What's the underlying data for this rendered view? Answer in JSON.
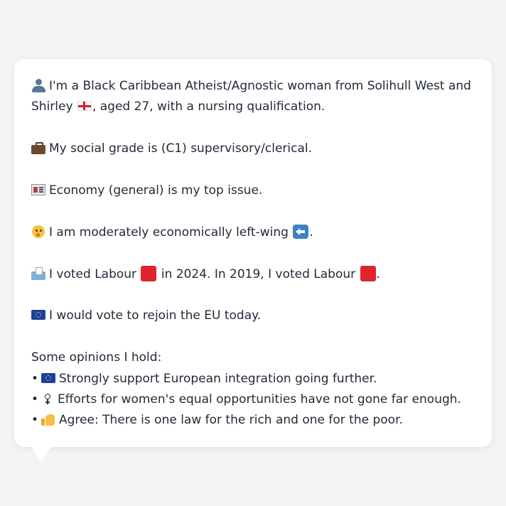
{
  "persona": {
    "intro_line1": "I'm a Black Caribbean Atheist/Agnostic woman from Solihull West and",
    "intro_line2_start": "Shirley",
    "intro_line2_end": ", aged 27, with a nursing qualification.",
    "social_grade": "My social grade is (C1) supervisory/clerical.",
    "top_issue": "Economy (general) is my top issue.",
    "economic_view": "I am moderately economically left-wing",
    "economic_view_end": ".",
    "vote_part1": "I voted Labour",
    "vote_part2": "in 2024. In 2019, I voted Labour",
    "vote_part3": ".",
    "eu_view": "I would vote to rejoin the EU today.",
    "opinions_heading": "Some opinions I hold:",
    "opinions": [
      {
        "bullet": "•",
        "icon": "eu-flag-icon",
        "text": "Strongly support European integration going further."
      },
      {
        "bullet": "•",
        "icon": "female-sign-icon",
        "text": "Efforts for women's equal opportunities have not gone far enough."
      },
      {
        "bullet": "•",
        "icon": "thumbs-up-icon",
        "text": "Agree: There is one law for the rich and one for the poor."
      }
    ]
  },
  "icons": {
    "intro": "person-icon",
    "location": "england-flag-icon",
    "grade": "briefcase-icon",
    "issue": "newspaper-icon",
    "economy": "thinking-face-icon",
    "direction": "left-arrow-icon",
    "vote": "ballot-box-icon",
    "party": "red-square-icon",
    "eu": "eu-flag-icon"
  },
  "colors": {
    "background": "#f3f4f6",
    "card": "#ffffff",
    "text": "#1f2937",
    "labour_red": "#e0242f"
  }
}
